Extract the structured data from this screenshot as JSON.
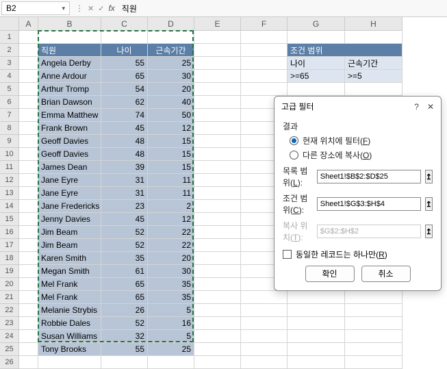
{
  "formula_bar": {
    "name_box": "B2",
    "fx_value": "직원"
  },
  "columns": [
    "A",
    "B",
    "C",
    "D",
    "E",
    "F",
    "G",
    "H"
  ],
  "header_row": {
    "b": "직원",
    "c": "나이",
    "d": "근속기간"
  },
  "data_rows": [
    {
      "b": "Angela Derby",
      "c": 55,
      "d": 25
    },
    {
      "b": "Anne Ardour",
      "c": 65,
      "d": 30
    },
    {
      "b": "Arthur Tromp",
      "c": 54,
      "d": 20
    },
    {
      "b": "Brian Dawson",
      "c": 62,
      "d": 40
    },
    {
      "b": "Emma Matthew",
      "c": 74,
      "d": 50
    },
    {
      "b": "Frank Brown",
      "c": 45,
      "d": 12
    },
    {
      "b": "Geoff Davies",
      "c": 48,
      "d": 15
    },
    {
      "b": "Geoff Davies",
      "c": 48,
      "d": 15
    },
    {
      "b": "James Dean",
      "c": 39,
      "d": 15
    },
    {
      "b": "Jane Eyre",
      "c": 31,
      "d": 11
    },
    {
      "b": "Jane Eyre",
      "c": 31,
      "d": 11
    },
    {
      "b": "Jane Fredericks",
      "c": 23,
      "d": 2
    },
    {
      "b": "Jenny Davies",
      "c": 45,
      "d": 12
    },
    {
      "b": "Jim Beam",
      "c": 52,
      "d": 22
    },
    {
      "b": "Jim Beam",
      "c": 52,
      "d": 22
    },
    {
      "b": "Karen Smith",
      "c": 35,
      "d": 20
    },
    {
      "b": "Megan Smith",
      "c": 61,
      "d": 30
    },
    {
      "b": "Mel Frank",
      "c": 65,
      "d": 35
    },
    {
      "b": "Mel Frank",
      "c": 65,
      "d": 35
    },
    {
      "b": "Melanie Strybis",
      "c": 26,
      "d": 5
    },
    {
      "b": "Robbie Dales",
      "c": 52,
      "d": 16
    },
    {
      "b": "Susan Williams",
      "c": 32,
      "d": 5
    },
    {
      "b": "Tony Brooks",
      "c": 55,
      "d": 25
    }
  ],
  "criteria": {
    "title": "조건 범위",
    "h1": "나이",
    "h2": "근속기간",
    "v1": ">=65",
    "v2": ">=5"
  },
  "dialog": {
    "title": "고급 필터",
    "result_label": "결과",
    "radio1": "현재 위치에 필터(",
    "radio1_key": "F",
    "radio1_end": ")",
    "radio2": "다른 장소에 복사(",
    "radio2_key": "O",
    "radio2_end": ")",
    "list_range_label": "목록 범위(",
    "list_range_key": "L",
    "list_range_end": "):",
    "list_range_value": "Sheet1!$B$2:$D$25",
    "crit_range_label": "조건 범위(",
    "crit_range_key": "C",
    "crit_range_end": "):",
    "crit_range_value": "Sheet1!$G$3:$H$4",
    "copy_to_label": "복사 위치(",
    "copy_to_key": "T",
    "copy_to_end": "):",
    "copy_to_value": "$G$2:$H$2",
    "unique_label": "동일한 레코드는 하나만(",
    "unique_key": "R",
    "unique_end": ")",
    "ok": "확인",
    "cancel": "취소"
  }
}
